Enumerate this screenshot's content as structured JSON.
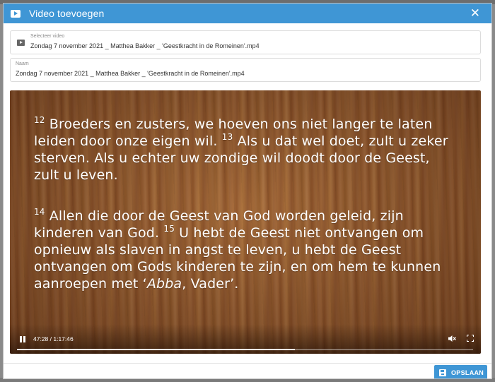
{
  "modal": {
    "title": "Video toevoegen",
    "close_symbol": "✕",
    "header_icon": "video-icon"
  },
  "fields": {
    "video": {
      "label": "Selecteer video",
      "value": "Zondag 7 november 2021 _ Matthea Bakker _ 'Geestkracht in de Romeinen'.mp4",
      "icon": "video-file-icon"
    },
    "name": {
      "label": "Naam",
      "value": "Zondag 7 november 2021 _ Matthea Bakker _ 'Geestkracht  in de Romeinen'.mp4"
    }
  },
  "video_frame": {
    "verse_12_num": "12",
    "verse_12_text": " Broeders en zusters, we hoeven ons niet langer te laten leiden door onze eigen wil. ",
    "verse_13_num": "13",
    "verse_13_text": " Als u dat wel doet, zult u zeker sterven. Als u echter uw zondige wil doodt door de Geest, zult u leven.",
    "verse_14_num": "14",
    "verse_14_text": " Allen die door de Geest van God worden geleid, zijn kinderen van God. ",
    "verse_15_num": "15",
    "verse_15_text_a": " U hebt de Geest niet ontvangen om opnieuw als slaven in angst te leven, u hebt de Geest ontvangen om Gods kinderen te zijn, en om hem te kunnen aanroepen met ‘",
    "verse_15_italic": "Abba",
    "verse_15_text_b": ", Vader’."
  },
  "player": {
    "time": "47:28 / 1:17:46",
    "progress": 0.61,
    "icons": [
      "pause-icon",
      "mute-icon",
      "fullscreen-icon"
    ]
  },
  "footer": {
    "save_label": "OPSLAAN",
    "save_icon": "save-icon"
  },
  "colors": {
    "accent": "#3f96d5"
  }
}
